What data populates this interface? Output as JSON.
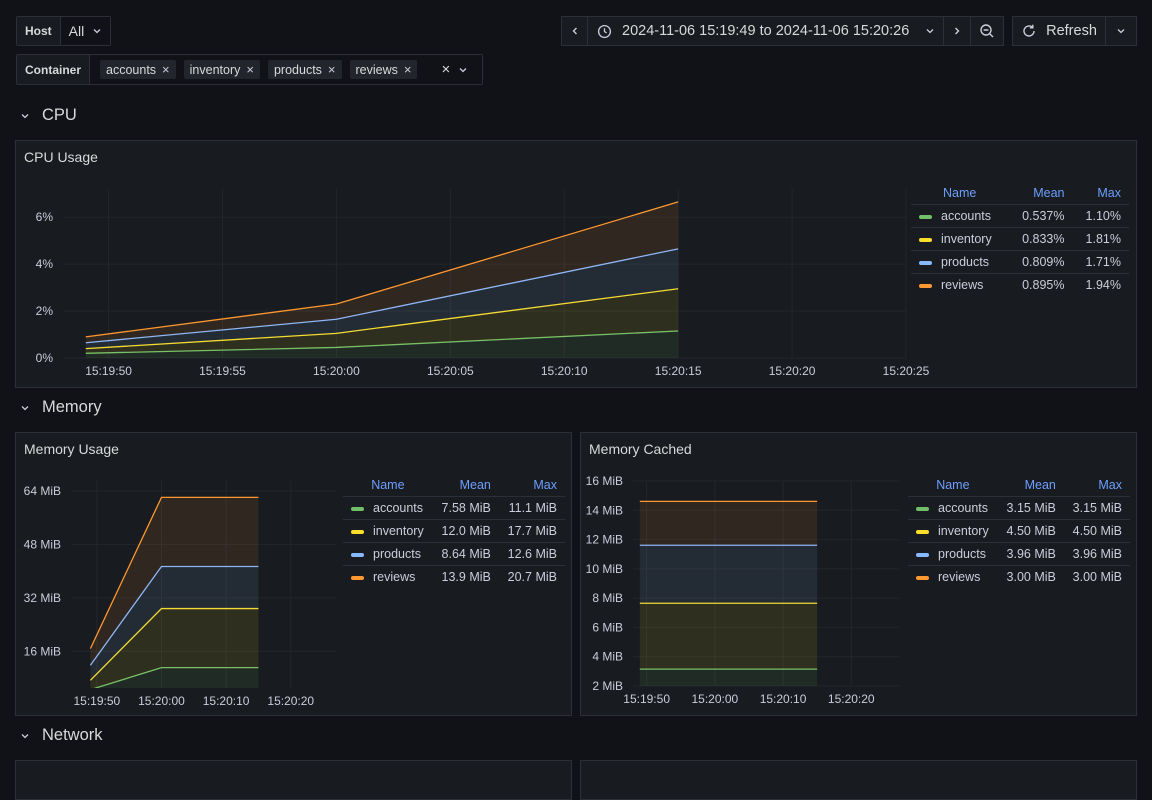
{
  "variables": {
    "host": {
      "label": "Host",
      "value": "All"
    },
    "container": {
      "label": "Container",
      "chips": [
        "accounts",
        "inventory",
        "products",
        "reviews"
      ]
    }
  },
  "timepicker": {
    "range": "2024-11-06 15:19:49 to 2024-11-06 15:20:26"
  },
  "refresh": {
    "label": "Refresh"
  },
  "colors": {
    "accounts": "#73bf69",
    "inventory": "#fade2a",
    "products": "#8ab8ff",
    "reviews": "#ff9830"
  },
  "rows": {
    "cpu": "CPU",
    "memory": "Memory",
    "network": "Network"
  },
  "legend_headers": {
    "name": "Name",
    "mean": "Mean",
    "max": "Max"
  },
  "panels": {
    "cpu": {
      "title": "CPU Usage",
      "legend": [
        {
          "name": "accounts",
          "mean": "0.537%",
          "max": "1.10%"
        },
        {
          "name": "inventory",
          "mean": "0.833%",
          "max": "1.81%"
        },
        {
          "name": "products",
          "mean": "0.809%",
          "max": "1.71%"
        },
        {
          "name": "reviews",
          "mean": "0.895%",
          "max": "1.94%"
        }
      ],
      "chart_data": {
        "type": "area",
        "stacked": true,
        "x": [
          "15:19:49",
          "15:20:00",
          "15:20:15"
        ],
        "xticks": [
          "15:19:50",
          "15:19:55",
          "15:20:00",
          "15:20:05",
          "15:20:10",
          "15:20:15",
          "15:20:20",
          "15:20:25"
        ],
        "yticks": [
          "0%",
          "2%",
          "4%",
          "6%"
        ],
        "ylim": [
          0,
          7.2
        ],
        "series": [
          {
            "name": "accounts",
            "values": [
              0.2,
              0.45,
              1.15
            ]
          },
          {
            "name": "inventory",
            "values": [
              0.2,
              0.6,
              1.8
            ]
          },
          {
            "name": "products",
            "values": [
              0.25,
              0.6,
              1.7
            ]
          },
          {
            "name": "reviews",
            "values": [
              0.25,
              0.65,
              2.0
            ]
          }
        ]
      }
    },
    "memory_usage": {
      "title": "Memory Usage",
      "legend": [
        {
          "name": "accounts",
          "mean": "7.58 MiB",
          "max": "11.1 MiB"
        },
        {
          "name": "inventory",
          "mean": "12.0 MiB",
          "max": "17.7 MiB"
        },
        {
          "name": "products",
          "mean": "8.64 MiB",
          "max": "12.6 MiB"
        },
        {
          "name": "reviews",
          "mean": "13.9 MiB",
          "max": "20.7 MiB"
        }
      ],
      "chart_data": {
        "type": "area",
        "stacked": true,
        "x": [
          "15:19:49",
          "15:20:00",
          "15:20:15"
        ],
        "xticks": [
          "15:19:50",
          "15:20:00",
          "15:20:10",
          "15:20:20"
        ],
        "yticks": [
          "16 MiB",
          "32 MiB",
          "48 MiB",
          "64 MiB"
        ],
        "ylim": [
          5,
          67
        ],
        "series": [
          {
            "name": "accounts",
            "values": [
              4.5,
              11.1,
              11.1
            ]
          },
          {
            "name": "inventory",
            "values": [
              2.8,
              17.7,
              17.7
            ]
          },
          {
            "name": "products",
            "values": [
              4.5,
              12.6,
              12.6
            ]
          },
          {
            "name": "reviews",
            "values": [
              5.0,
              20.7,
              20.7
            ]
          }
        ]
      }
    },
    "memory_cached": {
      "title": "Memory Cached",
      "legend": [
        {
          "name": "accounts",
          "mean": "3.15 MiB",
          "max": "3.15 MiB"
        },
        {
          "name": "inventory",
          "mean": "4.50 MiB",
          "max": "4.50 MiB"
        },
        {
          "name": "products",
          "mean": "3.96 MiB",
          "max": "3.96 MiB"
        },
        {
          "name": "reviews",
          "mean": "3.00 MiB",
          "max": "3.00 MiB"
        }
      ],
      "chart_data": {
        "type": "area",
        "stacked": true,
        "x": [
          "15:19:49",
          "15:20:15"
        ],
        "xticks": [
          "15:19:50",
          "15:20:00",
          "15:20:10",
          "15:20:20"
        ],
        "yticks": [
          "2 MiB",
          "4 MiB",
          "6 MiB",
          "8 MiB",
          "10 MiB",
          "12 MiB",
          "14 MiB",
          "16 MiB"
        ],
        "ylim": [
          2,
          16
        ],
        "series": [
          {
            "name": "accounts",
            "values": [
              3.15,
              3.15
            ]
          },
          {
            "name": "inventory",
            "values": [
              4.5,
              4.5
            ]
          },
          {
            "name": "products",
            "values": [
              3.96,
              3.96
            ]
          },
          {
            "name": "reviews",
            "values": [
              3.0,
              3.0
            ]
          }
        ]
      }
    }
  }
}
